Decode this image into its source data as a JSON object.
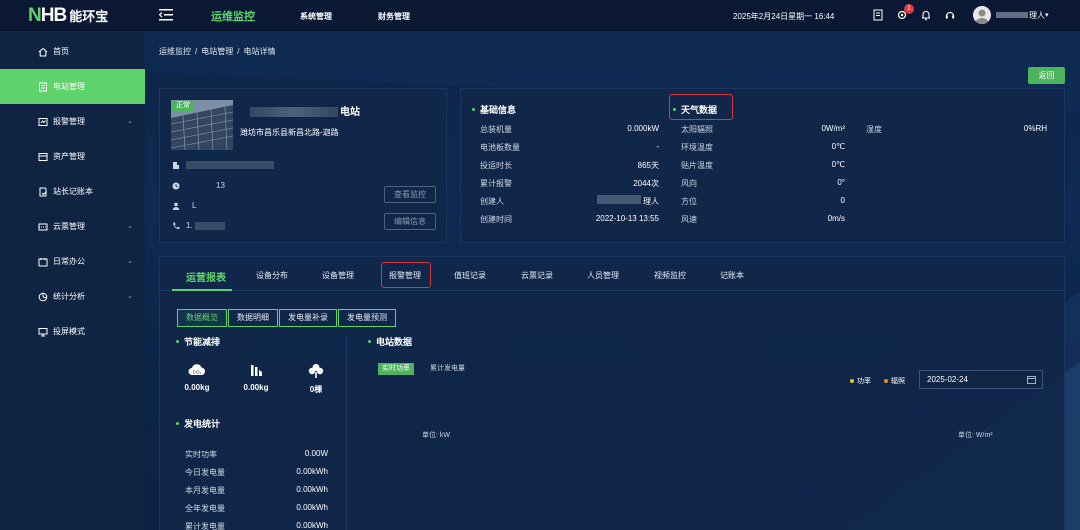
{
  "app": {
    "logo_mark": "NHB",
    "logo_text": "能环宝"
  },
  "top_nav": {
    "items": [
      "运维监控",
      "系统管理",
      "财务管理"
    ],
    "active_index": 0
  },
  "header": {
    "datetime": "2025年2月24日星期一 16:44",
    "notification_count": "1",
    "user_suffix": "理人"
  },
  "sidebar": {
    "items": [
      {
        "label": "首页",
        "icon": "home-icon"
      },
      {
        "label": "电站管理",
        "icon": "station-icon",
        "active": true
      },
      {
        "label": "报警管理",
        "icon": "alarm-icon",
        "expandable": true
      },
      {
        "label": "资产管理",
        "icon": "asset-icon"
      },
      {
        "label": "站长记账本",
        "icon": "ledger-icon"
      },
      {
        "label": "云票管理",
        "icon": "cloud-ticket-icon",
        "expandable": true
      },
      {
        "label": "日常办公",
        "icon": "office-icon",
        "expandable": true
      },
      {
        "label": "统计分析",
        "icon": "stats-icon",
        "expandable": true
      },
      {
        "label": "投屏模式",
        "icon": "screen-icon"
      }
    ]
  },
  "breadcrumb": [
    "运维监控",
    "/",
    "电站管理",
    "/",
    "电站详情"
  ],
  "back_label": "返回",
  "station": {
    "status_tag": "正常",
    "name_suffix": "电站",
    "address": "潍坊市昌乐县新昌北路-迦路",
    "row_value": "13",
    "contact_prefix": "1.",
    "btn_view": "查看监控",
    "btn_edit": "编辑信息"
  },
  "basic_info": {
    "title": "基础信息",
    "rows": [
      {
        "label": "总装机量",
        "value": "0.000kW"
      },
      {
        "label": "电池板数量",
        "value": "-"
      },
      {
        "label": "投运时长",
        "value": "865天"
      },
      {
        "label": "累计报警",
        "value": "2044次"
      },
      {
        "label": "创建人",
        "value": "理人"
      },
      {
        "label": "创建时间",
        "value": "2022-10-13 13:55"
      }
    ]
  },
  "weather": {
    "title": "天气数据",
    "rows": [
      {
        "label": "太阳辐照",
        "value": "0W/m²"
      },
      {
        "label": "环境温度",
        "value": "0℃"
      },
      {
        "label": "贴片温度",
        "value": "0℃"
      },
      {
        "label": "风向",
        "value": "0°"
      },
      {
        "label": "方位",
        "value": "0"
      },
      {
        "label": "风速",
        "value": "0m/s"
      }
    ],
    "humidity_label": "湿度",
    "humidity_value": "0%RH"
  },
  "tabs": [
    "运营报表",
    "设备分布",
    "设备管理",
    "报警管理",
    "值班记录",
    "云票记录",
    "人员管理",
    "视频监控",
    "记账本"
  ],
  "subtabs": [
    "数据概览",
    "数据明细",
    "发电量补录",
    "发电量预测"
  ],
  "energy_saving": {
    "title": "节能减排",
    "items": [
      {
        "value": "0.00kg",
        "icon": "co2-cloud-icon"
      },
      {
        "value": "0.00kg",
        "icon": "factory-icon"
      },
      {
        "value": "0棵",
        "icon": "tree-icon"
      }
    ]
  },
  "generation": {
    "title": "发电统计",
    "rows": [
      {
        "label": "实时功率",
        "value": "0.00W"
      },
      {
        "label": "今日发电量",
        "value": "0.00kWh"
      },
      {
        "label": "本月发电量",
        "value": "0.00kWh"
      },
      {
        "label": "全年发电量",
        "value": "0.00kWh"
      },
      {
        "label": "累计发电量",
        "value": "0.00kWh"
      }
    ]
  },
  "station_data": {
    "title": "电站数据",
    "chart_tabs": [
      "实时功率",
      "累计发电量"
    ],
    "legend": [
      {
        "name": "功率",
        "color": "#f0c419"
      },
      {
        "name": "辐照",
        "color": "#f08a24"
      }
    ],
    "date": "2025-02-24",
    "unit_left": "单位:  kW",
    "unit_right": "单位:  W/m²"
  }
}
